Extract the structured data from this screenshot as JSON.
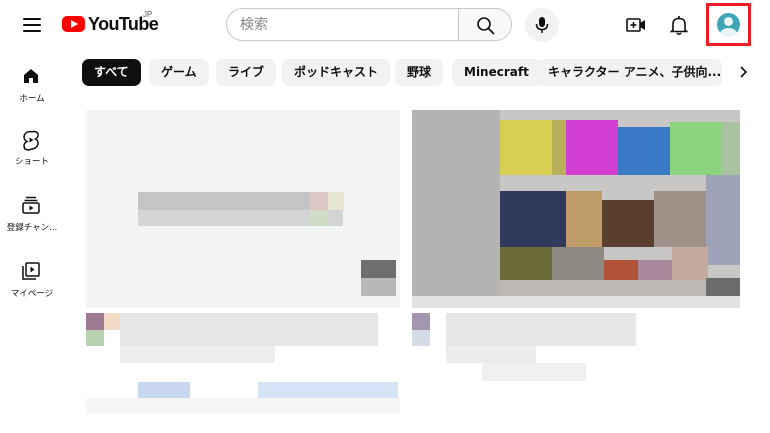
{
  "header": {
    "logo_text": "YouTube",
    "region": "JP",
    "search_placeholder": "検索"
  },
  "sidebar": {
    "items": [
      {
        "label": "ホーム"
      },
      {
        "label": "ショート"
      },
      {
        "label": "登録チャン..."
      },
      {
        "label": "マイページ"
      }
    ]
  },
  "chips": [
    {
      "label": "すべて",
      "active": true
    },
    {
      "label": "ゲーム"
    },
    {
      "label": "ライブ"
    },
    {
      "label": "ポッドキャスト"
    },
    {
      "label": "野球"
    },
    {
      "label": "Minecraft"
    },
    {
      "label": "キャラクター アニメ、子供向..."
    }
  ],
  "colors": {
    "brand_red": "#ff0000",
    "highlight_box": "#ee1c24",
    "avatar": "#3fa6b8",
    "chip_active_bg": "#0f0f0f",
    "chip_bg": "#f2f2f2"
  }
}
